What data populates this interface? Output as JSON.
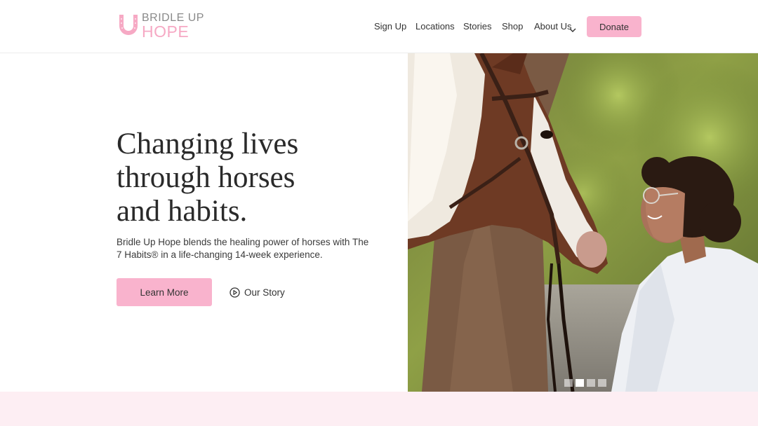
{
  "logo": {
    "top_text": "BRIDLE UP",
    "bottom_text": "HOPE",
    "icon": "horseshoe-icon",
    "color": "#f6a9c4"
  },
  "nav": {
    "items": [
      {
        "label": "Sign Up"
      },
      {
        "label": "Locations"
      },
      {
        "label": "Stories"
      },
      {
        "label": "Shop"
      },
      {
        "label": "About Us"
      }
    ],
    "about_icon": "chevron-down-icon",
    "donate_label": "Donate"
  },
  "hero": {
    "title_lines": [
      "Changing lives",
      "through horses",
      "and habits."
    ],
    "subtitle": "Bridle Up Hope blends the healing power of horses with The 7 Habits® in a life-changing 14-week experience.",
    "primary_button": "Learn More",
    "secondary_button": "Our Story",
    "secondary_icon": "play-circle-icon",
    "image": "photo-woman-with-horse"
  },
  "carousel": {
    "slide_count": 4,
    "active_index": 1
  },
  "colors": {
    "accent": "#f9b3cd",
    "band": "#fdeef3",
    "text": "#2a2a2a"
  }
}
